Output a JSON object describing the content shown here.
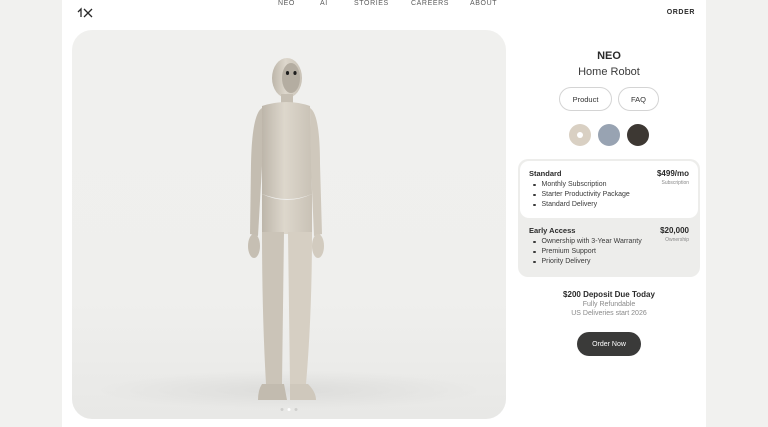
{
  "nav": {
    "logo_icon": "1x-logo-icon",
    "links": [
      "NEO",
      "AI",
      "STORIES",
      "CAREERS",
      "ABOUT"
    ],
    "order_label": "ORDER"
  },
  "hero": {
    "image": "neo-robot-standing-image",
    "carousel_dots": 3,
    "active_dot": 1
  },
  "product": {
    "title": "NEO",
    "subtitle": "Home Robot",
    "tabs": [
      "Product",
      "FAQ"
    ],
    "colors": [
      {
        "name": "beige-swatch",
        "hex": "#d9d0c3",
        "selected": true
      },
      {
        "name": "blue-gray-swatch",
        "hex": "#98a3b2",
        "selected": false
      },
      {
        "name": "dark-brown-swatch",
        "hex": "#3d3833",
        "selected": false
      }
    ]
  },
  "plans": [
    {
      "name": "Standard",
      "price": "$499/mo",
      "note": "Subscription",
      "features": [
        "Monthly Subscription",
        "Starter Productivity Package",
        "Standard Delivery"
      ],
      "selected": true
    },
    {
      "name": "Early Access",
      "price": "$20,000",
      "note": "Ownership",
      "features": [
        "Ownership with 3-Year Warranty",
        "Premium Support",
        "Priority Delivery"
      ],
      "selected": false
    }
  ],
  "deposit": {
    "title": "$200 Deposit Due Today",
    "line1": "Fully Refundable",
    "line2": "US Deliveries start 2026"
  },
  "cta": {
    "label": "Order Now"
  },
  "colors": {
    "page_bg": "#f1f1ef",
    "panel_bg": "#ffffff",
    "button_bg": "#3a3a39"
  }
}
